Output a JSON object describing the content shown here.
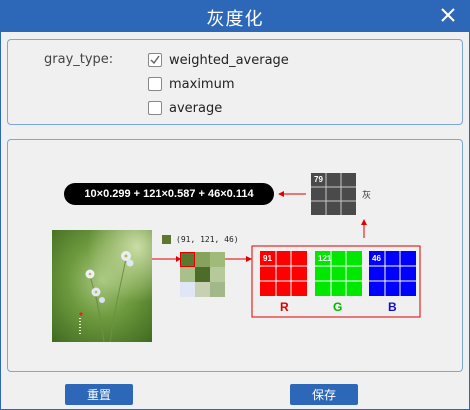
{
  "window": {
    "title": "灰度化"
  },
  "options": {
    "label": "gray_type:",
    "items": [
      {
        "label": "weighted_average",
        "checked": true
      },
      {
        "label": "maximum",
        "checked": false
      },
      {
        "label": "average",
        "checked": false
      }
    ]
  },
  "illustration": {
    "formula": "10×0.299 + 121×0.587 + 46×0.114",
    "pixel_rgb": "(91, 121, 46)",
    "pixel_color": "#5b792e",
    "gray_value": "79",
    "gray_label": "灰",
    "channels": [
      {
        "label": "R",
        "value": "91",
        "color": "#ff0000",
        "label_color": "#e00000"
      },
      {
        "label": "G",
        "value": "121",
        "color": "#00e800",
        "label_color": "#00b800"
      },
      {
        "label": "B",
        "value": "46",
        "color": "#0000ff",
        "label_color": "#1010cc"
      }
    ]
  },
  "buttons": {
    "reset": "重置",
    "save": "保存"
  }
}
